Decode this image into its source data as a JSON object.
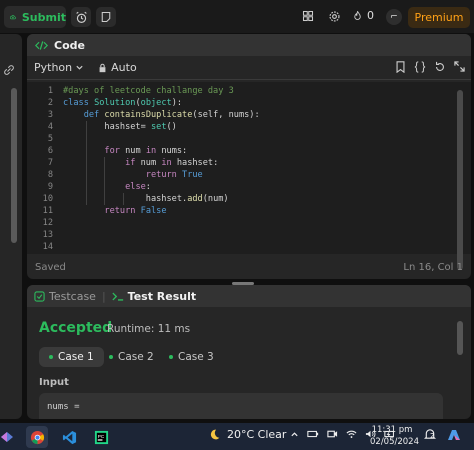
{
  "topbar": {
    "submit_label": "Submit",
    "streak_count": "0",
    "premium_label": "Premium",
    "avatar_char": "⌐"
  },
  "code": {
    "title": "Code",
    "language": "Python",
    "mode": "Auto",
    "status_left": "Saved",
    "status_right": "Ln 16, Col 1",
    "lines": [
      {
        "n": "1",
        "t": "#days of leetcode challange day 3"
      },
      {
        "n": "2",
        "t": "class Solution(object):"
      },
      {
        "n": "3",
        "t": "    def containsDuplicate(self, nums):"
      },
      {
        "n": "4",
        "t": "        hashset= set()"
      },
      {
        "n": "5",
        "t": ""
      },
      {
        "n": "6",
        "t": "        for num in nums:"
      },
      {
        "n": "7",
        "t": "            if num in hashset:"
      },
      {
        "n": "8",
        "t": "                return True"
      },
      {
        "n": "9",
        "t": "            else:"
      },
      {
        "n": "10",
        "t": "                hashset.add(num)"
      },
      {
        "n": "11",
        "t": "        return False"
      },
      {
        "n": "12",
        "t": ""
      },
      {
        "n": "13",
        "t": ""
      },
      {
        "n": "14",
        "t": ""
      }
    ]
  },
  "result": {
    "tab_testcase": "Testcase",
    "tab_result": "Test Result",
    "status": "Accepted",
    "runtime": "Runtime: 11 ms",
    "cases": [
      "Case 1",
      "Case 2",
      "Case 3"
    ],
    "input_label": "Input",
    "input_value": "nums ="
  },
  "taskbar": {
    "weather": "20°C  Clear",
    "time": "11:31 pm",
    "date": "02/05/2024",
    "notif_count": "2"
  }
}
